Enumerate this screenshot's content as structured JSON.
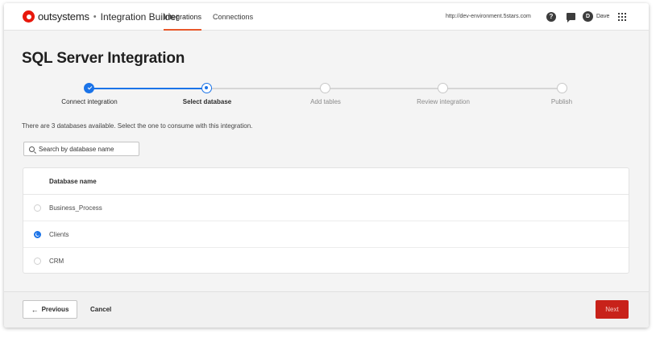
{
  "header": {
    "brand": "outsystems",
    "separator": "•",
    "product": "Integration Builder",
    "tabs": [
      {
        "label": "Integrations",
        "active": true
      },
      {
        "label": "Connections",
        "active": false
      }
    ],
    "environment_url": "http://dev-environment.5stars.com",
    "help_glyph": "?",
    "avatar_initial": "D",
    "user_name": "Dave",
    "icons": [
      "help-icon",
      "chat-icon",
      "apps-grid-icon"
    ]
  },
  "page": {
    "title": "SQL Server Integration",
    "description": "There are 3 databases available. Select the one to consume with this integration."
  },
  "stepper": {
    "steps": [
      {
        "label": "Connect integration",
        "state": "done"
      },
      {
        "label": "Select database",
        "state": "current"
      },
      {
        "label": "Add tables",
        "state": "pending"
      },
      {
        "label": "Review integration",
        "state": "pending"
      },
      {
        "label": "Publish",
        "state": "pending"
      }
    ]
  },
  "search": {
    "placeholder": "Search by database name",
    "value": ""
  },
  "table": {
    "header": "Database name",
    "rows": [
      {
        "name": "Business_Process",
        "selected": false
      },
      {
        "name": "Clients",
        "selected": true
      },
      {
        "name": "CRM",
        "selected": false
      }
    ]
  },
  "footer": {
    "previous_label": "Previous",
    "previous_arrow": "←",
    "cancel_label": "Cancel",
    "next_label": "Next"
  },
  "colors": {
    "brand_red": "#e8180c",
    "accent_blue": "#1a73e8",
    "tab_underline": "#e8582a",
    "next_button": "#c8221a"
  }
}
